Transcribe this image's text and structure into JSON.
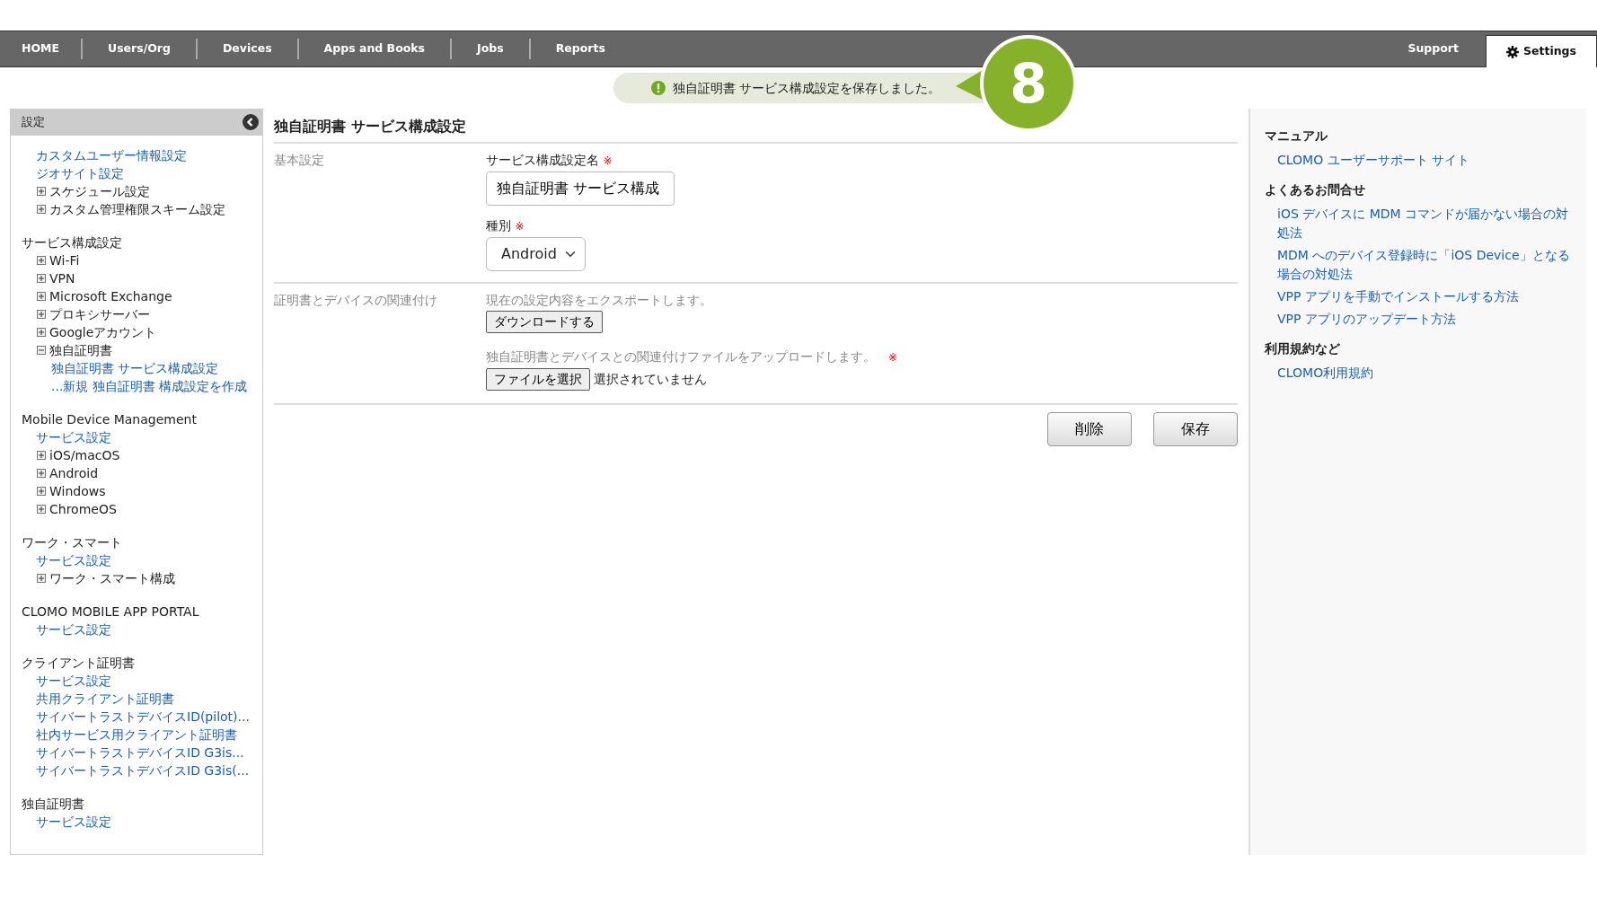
{
  "navbar": {
    "tabs": [
      {
        "label": "HOME",
        "selected": false
      },
      {
        "label": "Users/Org",
        "selected": false
      },
      {
        "label": "Devices",
        "selected": false
      },
      {
        "label": "Apps and Books",
        "selected": false
      },
      {
        "label": "Jobs",
        "selected": false
      },
      {
        "label": "Reports",
        "selected": false
      }
    ],
    "right_tabs": [
      {
        "label": "Support",
        "selected": false,
        "kind": "plain"
      },
      {
        "label": "Settings",
        "selected": true,
        "kind": "gear"
      }
    ]
  },
  "toast": {
    "message": "独自証明書 サービス構成設定を保存しました。"
  },
  "step_badge": "8",
  "sidebar": {
    "title": "設定",
    "sections": [
      {
        "items": [
          {
            "kind": "link",
            "label": "カスタムユーザー情報設定"
          },
          {
            "kind": "link",
            "label": "ジオサイト設定"
          },
          {
            "kind": "node",
            "label": "スケジュール設定",
            "expanded": false
          },
          {
            "kind": "node",
            "label": "カスタム管理権限スキーム設定",
            "expanded": false
          }
        ]
      },
      {
        "heading": "サービス構成設定",
        "items": [
          {
            "kind": "node",
            "label": "Wi-Fi",
            "expanded": false
          },
          {
            "kind": "node",
            "label": "VPN",
            "expanded": false
          },
          {
            "kind": "node",
            "label": "Microsoft Exchange",
            "expanded": false
          },
          {
            "kind": "node",
            "label": "プロキシサーバー",
            "expanded": false
          },
          {
            "kind": "node",
            "label": "Googleアカウント",
            "expanded": false
          },
          {
            "kind": "node",
            "label": "独自証明書",
            "expanded": true,
            "children": [
              {
                "label": "独自証明書 サービス構成設定"
              },
              {
                "label": "...新規 独自証明書 構成設定を作成"
              }
            ]
          }
        ]
      },
      {
        "heading": "Mobile Device Management",
        "items": [
          {
            "kind": "link",
            "label": "サービス設定"
          },
          {
            "kind": "node",
            "label": "iOS/macOS",
            "expanded": false
          },
          {
            "kind": "node",
            "label": "Android",
            "expanded": false
          },
          {
            "kind": "node",
            "label": "Windows",
            "expanded": false
          },
          {
            "kind": "node",
            "label": "ChromeOS",
            "expanded": false
          }
        ]
      },
      {
        "heading": "ワーク・スマート",
        "items": [
          {
            "kind": "link",
            "label": "サービス設定"
          },
          {
            "kind": "node",
            "label": "ワーク・スマート構成",
            "expanded": false
          }
        ]
      },
      {
        "heading": "CLOMO MOBILE APP PORTAL",
        "items": [
          {
            "kind": "link",
            "label": "サービス設定"
          }
        ]
      },
      {
        "heading": "クライアント証明書",
        "items": [
          {
            "kind": "link",
            "label": "サービス設定"
          },
          {
            "kind": "link",
            "label": "共用クライアント証明書"
          },
          {
            "kind": "link",
            "label": "サイバートラストデバイスID(pilot)..."
          },
          {
            "kind": "link",
            "label": "社内サービス用クライアント証明書"
          },
          {
            "kind": "link",
            "label": "サイバートラストデバイスID G3is..."
          },
          {
            "kind": "link",
            "label": "サイバートラストデバイスID G3is(..."
          }
        ]
      },
      {
        "heading": "独自証明書",
        "items": [
          {
            "kind": "link",
            "label": "サービス設定"
          }
        ]
      }
    ]
  },
  "main": {
    "title": "独自証明書 サービス構成設定",
    "basic": {
      "label": "基本設定",
      "name_label": "サービス構成設定名",
      "name_required": "※",
      "name_value": "独自証明書 サービス構成",
      "type_label": "種別",
      "type_required": "※",
      "type_value": "Android"
    },
    "association": {
      "label": "証明書とデバイスの関連付け",
      "export_text": "現在の設定内容をエクスポートします。",
      "download_button": "ダウンロードする",
      "upload_text": "独自証明書とデバイスとの関連付けファイルをアップロードします。",
      "upload_required": "※",
      "file_button": "ファイルを選択",
      "file_status": "選択されていません"
    },
    "buttons": [
      "削除",
      "保存"
    ]
  },
  "help": [
    {
      "heading": "マニュアル",
      "links": [
        "CLOMO ユーザーサポート サイト"
      ]
    },
    {
      "heading": "よくあるお問合せ",
      "links": [
        "iOS デバイスに MDM コマンドが届かない場合の対処法",
        "MDM へのデバイス登録時に「iOS Device」となる場合の対処法",
        "VPP アプリを手動でインストールする方法",
        "VPP アプリのアップデート方法"
      ]
    },
    {
      "heading": "利用規約など",
      "links": [
        "CLOMO利用規約"
      ]
    }
  ]
}
